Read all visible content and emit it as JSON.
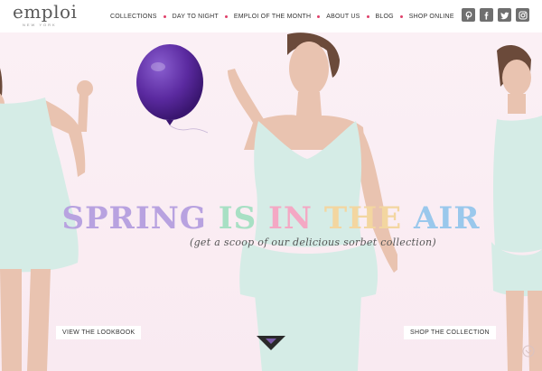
{
  "brand": {
    "name": "emploi",
    "tagline": "NEW YORK"
  },
  "nav": {
    "items": [
      {
        "label": "COLLECTIONS"
      },
      {
        "label": "DAY TO NIGHT"
      },
      {
        "label": "EMPLOI OF THE MONTH"
      },
      {
        "label": "ABOUT US"
      },
      {
        "label": "BLOG"
      },
      {
        "label": "SHOP ONLINE"
      }
    ]
  },
  "social": [
    {
      "name": "pinterest-icon"
    },
    {
      "name": "facebook-icon"
    },
    {
      "name": "twitter-icon"
    },
    {
      "name": "instagram-icon"
    }
  ],
  "hero": {
    "headline": {
      "w1": "SPRING",
      "w2": "IS",
      "w3": "IN",
      "w4": "THE",
      "w5": "AIR"
    },
    "subline": "(get a scoop of our delicious sorbet collection)",
    "cta_left": "VIEW THE LOOKBOOK",
    "cta_right": "SHOP THE COLLECTION"
  },
  "colors": {
    "accent_dot": "#e0406a",
    "headline": [
      "#b8a2e0",
      "#a8e0c4",
      "#f4a8c4",
      "#f3d6a0",
      "#9ac8ec"
    ],
    "balloon": "#5b2aa0",
    "dress": "#d5ece6"
  }
}
